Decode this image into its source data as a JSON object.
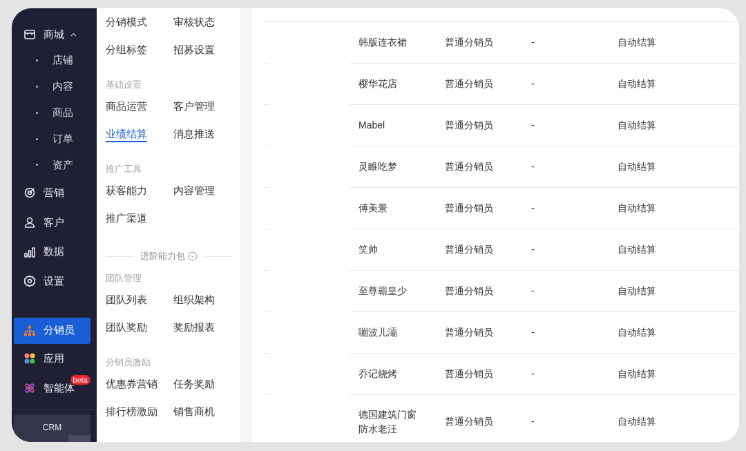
{
  "sidebar": {
    "items": [
      {
        "label": "商城",
        "selected": false,
        "expanded": true,
        "children": [
          {
            "label": "店铺"
          },
          {
            "label": "内容"
          },
          {
            "label": "商品"
          },
          {
            "label": "订单"
          },
          {
            "label": "资产"
          }
        ]
      },
      {
        "label": "营销",
        "selected": false
      },
      {
        "label": "客户",
        "selected": false
      },
      {
        "label": "数据",
        "selected": false
      },
      {
        "label": "设置",
        "selected": false
      },
      {
        "label": "分销员",
        "selected": true
      },
      {
        "label": "应用",
        "selected": false
      },
      {
        "label": "智能体",
        "selected": false,
        "badge": "beta"
      }
    ],
    "footer_card": {
      "label": "CRM"
    }
  },
  "menu": {
    "sections": [
      {
        "kind": "group",
        "items": [
          {
            "label": "分销模式",
            "selected": false
          },
          {
            "label": "审核状态",
            "selected": false
          },
          {
            "label": "分组标签",
            "selected": false
          },
          {
            "label": "招募设置",
            "selected": false
          }
        ]
      },
      {
        "kind": "group",
        "title": "基础设置",
        "items": [
          {
            "label": "商品运营",
            "selected": false
          },
          {
            "label": "客户管理",
            "selected": false
          },
          {
            "label": "业绩结算",
            "selected": true
          },
          {
            "label": "消息推送",
            "selected": false
          }
        ]
      },
      {
        "kind": "group",
        "title": "推广工具",
        "items": [
          {
            "label": "获客能力",
            "selected": false
          },
          {
            "label": "内容管理",
            "selected": false
          },
          {
            "label": "推广渠道",
            "selected": false
          }
        ]
      },
      {
        "kind": "divider",
        "label": "进阶能力包"
      },
      {
        "kind": "group",
        "title": "团队管理",
        "items": [
          {
            "label": "团队列表",
            "selected": false
          },
          {
            "label": "组织架构",
            "selected": false
          },
          {
            "label": "团队奖励",
            "selected": false
          },
          {
            "label": "奖励报表",
            "selected": false
          }
        ]
      },
      {
        "kind": "group",
        "title": "分销员激励",
        "items": [
          {
            "label": "优惠券营销",
            "selected": false
          },
          {
            "label": "任务奖励",
            "selected": false
          },
          {
            "label": "排行榜激励",
            "selected": false
          },
          {
            "label": "销售商机",
            "selected": false
          }
        ]
      }
    ]
  },
  "table": {
    "rows": [
      {
        "cells": [
          "韩版连衣裙",
          "普通分销员",
          "-",
          "自动结算"
        ]
      },
      {
        "cells": [
          "樱华花店",
          "普通分销员",
          "-",
          "自动结算"
        ]
      },
      {
        "cells": [
          "Mabel",
          "普通分销员",
          "-",
          "自动结算"
        ]
      },
      {
        "cells": [
          "灵睢吃梦",
          "普通分销员",
          "-",
          "自动结算"
        ]
      },
      {
        "cells": [
          "傅美景",
          "普通分销员",
          "-",
          "自动结算"
        ]
      },
      {
        "cells": [
          "笑帅",
          "普通分销员",
          "-",
          "自动结算"
        ]
      },
      {
        "cells": [
          "至尊霸皇少",
          "普通分销员",
          "-",
          "自动结算"
        ]
      },
      {
        "cells": [
          "嘣波儿灞",
          "普通分销员",
          "-",
          "自动结算"
        ]
      },
      {
        "cells": [
          "乔记烧烤",
          "普通分销员",
          "-",
          "自动结算"
        ]
      },
      {
        "cells": [
          "德国建筑门窗防水老汪",
          "普通分销员",
          "-",
          "自动结算"
        ]
      }
    ]
  }
}
